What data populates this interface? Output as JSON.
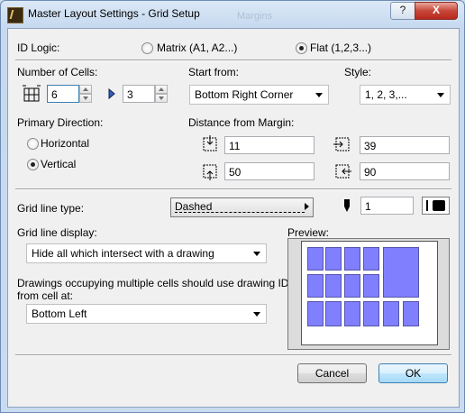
{
  "window": {
    "title": "Master Layout Settings - Grid Setup",
    "ghost_text": "Margins",
    "help_label": "?",
    "close_label": "X"
  },
  "id_logic": {
    "label": "ID Logic:",
    "options": [
      {
        "label": "Matrix (A1, A2...)",
        "selected": false
      },
      {
        "label": "Flat (1,2,3...)",
        "selected": true
      }
    ]
  },
  "cells": {
    "label": "Number of Cells:",
    "columns": "6",
    "rows": "3"
  },
  "start_from": {
    "label": "Start from:",
    "value": "Bottom Right Corner"
  },
  "style": {
    "label": "Style:",
    "value": "1, 2, 3,..."
  },
  "primary_direction": {
    "label": "Primary Direction:",
    "options": [
      {
        "label": "Horizontal",
        "selected": false
      },
      {
        "label": "Vertical",
        "selected": true
      }
    ]
  },
  "margins": {
    "label": "Distance from Margin:",
    "top": "11",
    "left": "39",
    "bottom": "50",
    "right": "90"
  },
  "grid_line_type": {
    "label": "Grid line type:",
    "value": "Dashed",
    "pen": "1"
  },
  "grid_line_display": {
    "label": "Grid line display:",
    "value": "Hide all which intersect with a drawing"
  },
  "multi_cell": {
    "label_line1": "Drawings occupying multiple cells should use drawing ID",
    "label_line2": "from cell at:",
    "value": "Bottom Left"
  },
  "preview": {
    "label": "Preview:",
    "fill_color": "#8080ff"
  },
  "buttons": {
    "cancel": "Cancel",
    "ok": "OK"
  }
}
